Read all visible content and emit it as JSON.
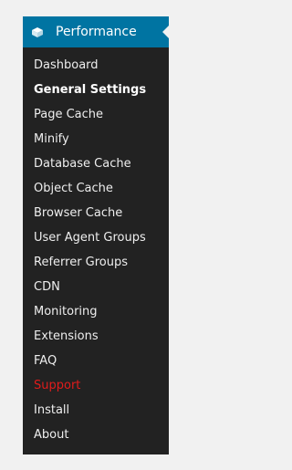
{
  "header": {
    "title": "Performance",
    "icon": "performance-icon",
    "background": "#0074a2"
  },
  "menu": {
    "background": "#222222",
    "items": [
      {
        "label": "Dashboard"
      },
      {
        "label": "General Settings",
        "active": true
      },
      {
        "label": "Page Cache"
      },
      {
        "label": "Minify"
      },
      {
        "label": "Database Cache"
      },
      {
        "label": "Object Cache"
      },
      {
        "label": "Browser Cache"
      },
      {
        "label": "User Agent Groups"
      },
      {
        "label": "Referrer Groups"
      },
      {
        "label": "CDN"
      },
      {
        "label": "Monitoring"
      },
      {
        "label": "Extensions"
      },
      {
        "label": "FAQ"
      },
      {
        "label": "Support",
        "color": "#e11b1b"
      },
      {
        "label": "Install"
      },
      {
        "label": "About"
      }
    ]
  }
}
